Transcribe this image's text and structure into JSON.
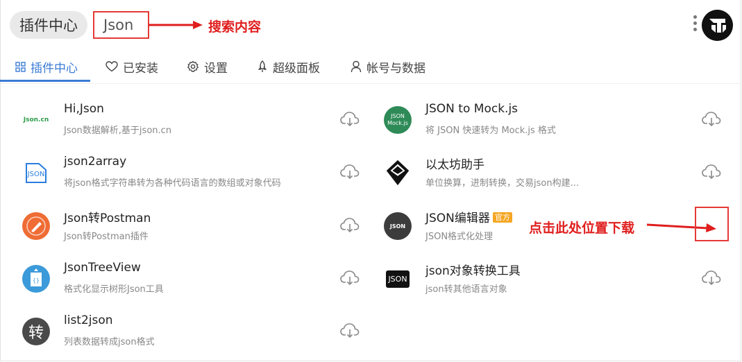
{
  "header": {
    "app_title": "插件中心",
    "search_value": "Json",
    "annotation_search": "搜索内容",
    "annotation_download": "点击此处位置下载"
  },
  "tabs": [
    {
      "label": "插件中心",
      "icon": "grid-icon",
      "active": true
    },
    {
      "label": "已安装",
      "icon": "heart-icon",
      "active": false
    },
    {
      "label": "设置",
      "icon": "gear-icon",
      "active": false
    },
    {
      "label": "超级面板",
      "icon": "rocket-icon",
      "active": false
    },
    {
      "label": "帐号与数据",
      "icon": "user-icon",
      "active": false
    }
  ],
  "plugins_left": [
    {
      "name": "Hi,Json",
      "desc": "Json数据解析,基于json.cn",
      "logo_text": "Json.cn"
    },
    {
      "name": "json2array",
      "desc": "将json格式字符串转为各种代码语言的数组或对象代码",
      "logo_text": "JSON"
    },
    {
      "name": "Json转Postman",
      "desc": "Json转Postman插件",
      "logo_text": ""
    },
    {
      "name": "JsonTreeView",
      "desc": "格式化显示树形Json工具",
      "logo_text": "{}"
    },
    {
      "name": "list2json",
      "desc": "列表数据转成json格式",
      "logo_text": "转"
    }
  ],
  "plugins_right": [
    {
      "name": "JSON to Mock.js",
      "desc": "将 JSON 快速转为 Mock.js 格式",
      "logo_text": "JSON Mock.js"
    },
    {
      "name": "以太坊助手",
      "desc": "单位换算，进制转换，交易json构建...",
      "logo_text": ""
    },
    {
      "name": "JSON编辑器",
      "desc": "JSON格式化处理",
      "logo_text": "JSON",
      "badge": "官方"
    },
    {
      "name": "json对象转换工具",
      "desc": "json转其他语言对象",
      "logo_text": "JSON"
    }
  ],
  "colors": {
    "accent": "#3a7bd5",
    "annotation": "#e01e1e",
    "badge": "#f5a623"
  }
}
